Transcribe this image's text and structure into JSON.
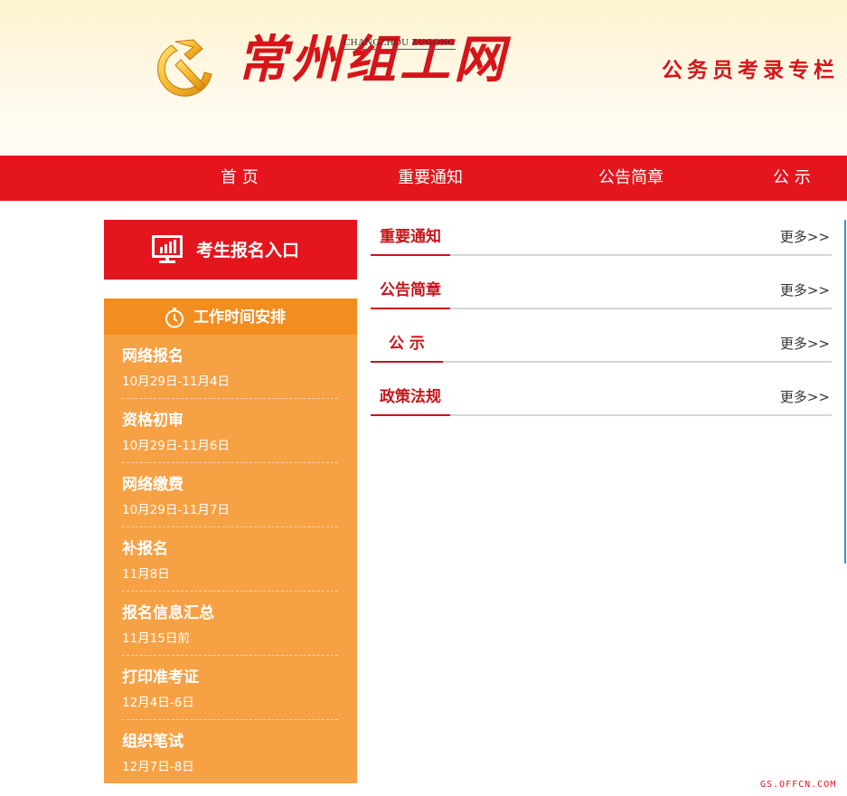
{
  "header": {
    "logo_text": "常州组工网",
    "logo_sub": "CHANGZHOU ZUGONG",
    "slogan": "公务员考录专栏"
  },
  "nav": {
    "items": [
      {
        "label": "首 页"
      },
      {
        "label": "重要通知"
      },
      {
        "label": "公告简章"
      },
      {
        "label": "公 示"
      }
    ]
  },
  "signup": {
    "label": "考生报名入口",
    "icon": "chart-monitor-icon"
  },
  "schedule": {
    "title": "工作时间安排",
    "icon": "stopwatch-icon",
    "items": [
      {
        "name": "网络报名",
        "date": "10月29日-11月4日"
      },
      {
        "name": "资格初审",
        "date": "10月29日-11月6日"
      },
      {
        "name": "网络缴费",
        "date": "10月29日-11月7日"
      },
      {
        "name": "补报名",
        "date": "11月8日"
      },
      {
        "name": "报名信息汇总",
        "date": "11月15日前"
      },
      {
        "name": "打印准考证",
        "date": "12月4日-6日"
      },
      {
        "name": "组织笔试",
        "date": "12月7日-8日"
      }
    ]
  },
  "sections": [
    {
      "title": "重要通知",
      "more": "更多>>"
    },
    {
      "title": "公告简章",
      "more": "更多>>"
    },
    {
      "title": "公 示",
      "more": "更多>>"
    },
    {
      "title": "政策法规",
      "more": "更多>>"
    }
  ],
  "watermark": "GS.OFFCN.COM",
  "colors": {
    "primary_red": "#e5151d",
    "orange_header": "#f28d1f",
    "orange_panel": "#f7a145"
  }
}
